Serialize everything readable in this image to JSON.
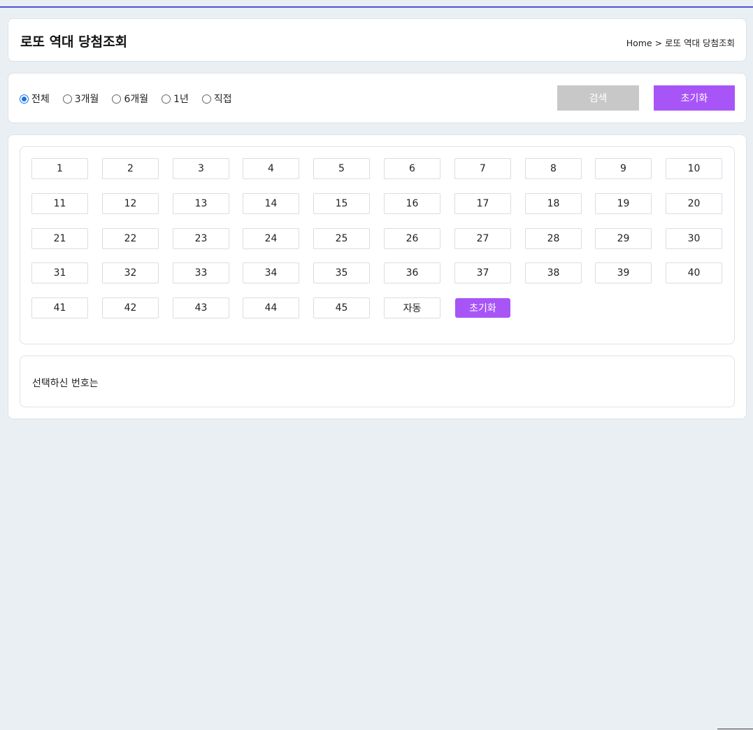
{
  "header": {
    "title": "로또 역대 당첨조회",
    "breadcrumb": "Home > 로또 역대 당첨조회"
  },
  "filter": {
    "periods": [
      {
        "label": "전체",
        "checked": true
      },
      {
        "label": "3개월",
        "checked": false
      },
      {
        "label": "6개월",
        "checked": false
      },
      {
        "label": "1년",
        "checked": false
      },
      {
        "label": "직접",
        "checked": false
      }
    ],
    "search_label": "검색",
    "reset_label": "초기화"
  },
  "numbers": {
    "values": [
      "1",
      "2",
      "3",
      "4",
      "5",
      "6",
      "7",
      "8",
      "9",
      "10",
      "11",
      "12",
      "13",
      "14",
      "15",
      "16",
      "17",
      "18",
      "19",
      "20",
      "21",
      "22",
      "23",
      "24",
      "25",
      "26",
      "27",
      "28",
      "29",
      "30",
      "31",
      "32",
      "33",
      "34",
      "35",
      "36",
      "37",
      "38",
      "39",
      "40",
      "41",
      "42",
      "43",
      "44",
      "45"
    ],
    "auto_label": "자동",
    "reset_label": "초기화"
  },
  "selected": {
    "label": "선택하신 번호는"
  },
  "colors": {
    "accent": "#a855f7",
    "disabled": "#c8c8c8",
    "top_line": "#4656d4",
    "background": "#eaeff4"
  }
}
